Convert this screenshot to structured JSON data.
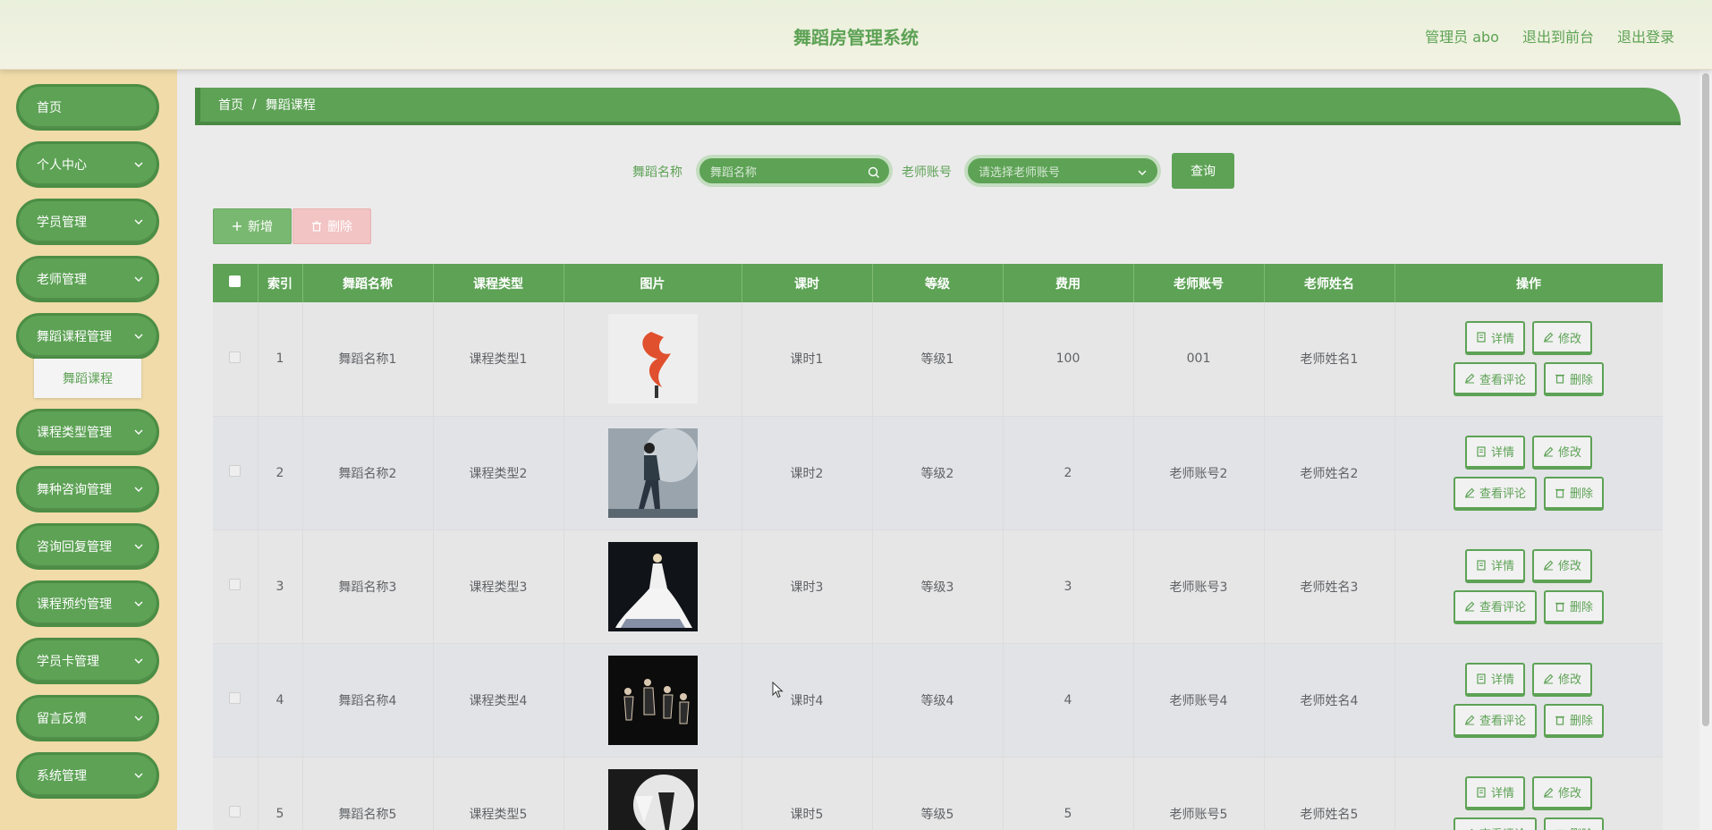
{
  "header": {
    "title": "舞蹈房管理系统",
    "links": [
      "管理员 abo",
      "退出到前台",
      "退出登录"
    ]
  },
  "sidebar": {
    "items": [
      {
        "label": "首页",
        "icon": "none"
      },
      {
        "label": "个人中心",
        "icon": "chevron-down-icon"
      },
      {
        "label": "学员管理",
        "icon": "chevron-down-icon"
      },
      {
        "label": "老师管理",
        "icon": "chevron-down-icon"
      },
      {
        "label": "舞蹈课程管理",
        "icon": "chevron-down-icon"
      },
      {
        "label": "课程类型管理",
        "icon": "chevron-down-icon"
      },
      {
        "label": "舞种咨询管理",
        "icon": "chevron-down-icon"
      },
      {
        "label": "咨询回复管理",
        "icon": "chevron-down-icon"
      },
      {
        "label": "课程预约管理",
        "icon": "chevron-down-icon"
      },
      {
        "label": "学员卡管理",
        "icon": "chevron-down-icon"
      },
      {
        "label": "留言反馈",
        "icon": "chevron-down-icon"
      },
      {
        "label": "系统管理",
        "icon": "chevron-down-icon"
      }
    ],
    "submenu": {
      "label": "舞蹈课程"
    }
  },
  "breadcrumb": {
    "home": "首页",
    "sep": "/",
    "current": "舞蹈课程"
  },
  "search": {
    "name_label": "舞蹈名称",
    "name_placeholder": "舞蹈名称",
    "teacher_label": "老师账号",
    "teacher_placeholder": "请选择老师账号",
    "query_button": "查询"
  },
  "actions": {
    "add": "新增",
    "delete": "删除"
  },
  "table": {
    "headers": [
      "索引",
      "舞蹈名称",
      "课程类型",
      "图片",
      "课时",
      "等级",
      "费用",
      "老师账号",
      "老师姓名",
      "操作"
    ],
    "rows": [
      {
        "index": "1",
        "name": "舞蹈名称1",
        "type": "课程类型1",
        "hours": "课时1",
        "level": "等级1",
        "fee": "100",
        "account": "001",
        "teacher": "老师姓名1"
      },
      {
        "index": "2",
        "name": "舞蹈名称2",
        "type": "课程类型2",
        "hours": "课时2",
        "level": "等级2",
        "fee": "2",
        "account": "老师账号2",
        "teacher": "老师姓名2"
      },
      {
        "index": "3",
        "name": "舞蹈名称3",
        "type": "课程类型3",
        "hours": "课时3",
        "level": "等级3",
        "fee": "3",
        "account": "老师账号3",
        "teacher": "老师姓名3"
      },
      {
        "index": "4",
        "name": "舞蹈名称4",
        "type": "课程类型4",
        "hours": "课时4",
        "level": "等级4",
        "fee": "4",
        "account": "老师账号4",
        "teacher": "老师姓名4"
      },
      {
        "index": "5",
        "name": "舞蹈名称5",
        "type": "课程类型5",
        "hours": "课时5",
        "level": "等级5",
        "fee": "5",
        "account": "老师账号5",
        "teacher": "老师姓名5"
      }
    ],
    "row_actions": {
      "detail": "详情",
      "edit": "修改",
      "comments": "查看评论",
      "delete": "删除"
    }
  },
  "colors": {
    "primary": "#5da255",
    "sidebar_bg": "#f0dba9",
    "danger_light": "#f2c4c4"
  }
}
